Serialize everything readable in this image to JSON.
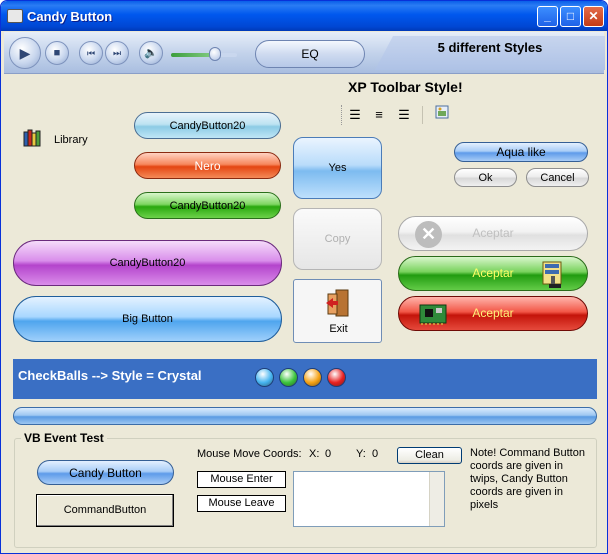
{
  "window": {
    "title": "Candy Button",
    "controls": [
      "minimize",
      "maximize",
      "close"
    ]
  },
  "media_bar": {
    "eq_label": "EQ",
    "styles_label": "5 different Styles",
    "volume_level": 0.75
  },
  "toolbar_section": {
    "title": "XP Toolbar Style!",
    "icons": [
      "align-left-icon",
      "align-center-icon",
      "align-right-icon",
      "picture-icon"
    ]
  },
  "library": {
    "label": "Library"
  },
  "buttons": {
    "candy1": "CandyButton20",
    "nero": "Nero",
    "candy2": "CandyButton20",
    "candy_big": "CandyButton20",
    "big_button": "Big Button",
    "yes": "Yes",
    "copy": "Copy",
    "exit": "Exit",
    "aqua_like": "Aqua like",
    "ok": "Ok",
    "cancel": "Cancel",
    "aceptar1": "Aceptar",
    "aceptar2": "Aceptar",
    "aceptar3": "Aceptar"
  },
  "checkballs": {
    "label": "CheckBalls --> Style = Crystal",
    "colors": [
      "#45B4F0",
      "#3CC43C",
      "#F5A214",
      "#E82020"
    ]
  },
  "event_test": {
    "group_title": "VB Event Test",
    "candy_button": "Candy Button",
    "command_button": "CommandButton",
    "mouse_move_label": "Mouse Move Coords:",
    "x_label": "X:",
    "x_value": "0",
    "y_label": "Y:",
    "y_value": "0",
    "clean_label": "Clean",
    "mouse_enter": "Mouse Enter",
    "mouse_leave": "Mouse Leave",
    "note": "Note! Command Button coords are given in twips, Candy Button coords are given in pixels"
  }
}
